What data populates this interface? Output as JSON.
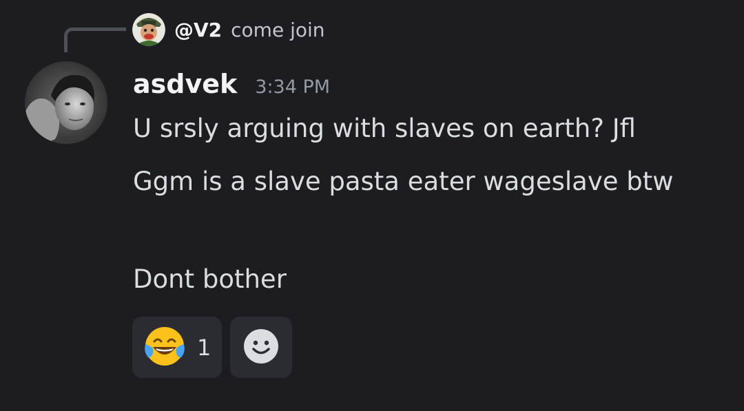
{
  "reply": {
    "author": "@V2",
    "text": "come join"
  },
  "message": {
    "author": "asdvek",
    "timestamp": "3:34 PM",
    "lines": [
      "U srsly arguing with slaves on earth? Jfl",
      "Ggm is a slave pasta eater wageslave btw",
      "Dont bother"
    ]
  },
  "reactions": [
    {
      "icon": "face-with-tears-of-joy-icon",
      "count": "1"
    }
  ],
  "add_reaction": {
    "icon": "smiley-add-reaction-icon"
  },
  "colors": {
    "background": "#1c1c21",
    "reaction_background": "#2b2c32",
    "text": "#dbdee1",
    "muted": "#949ba4"
  }
}
